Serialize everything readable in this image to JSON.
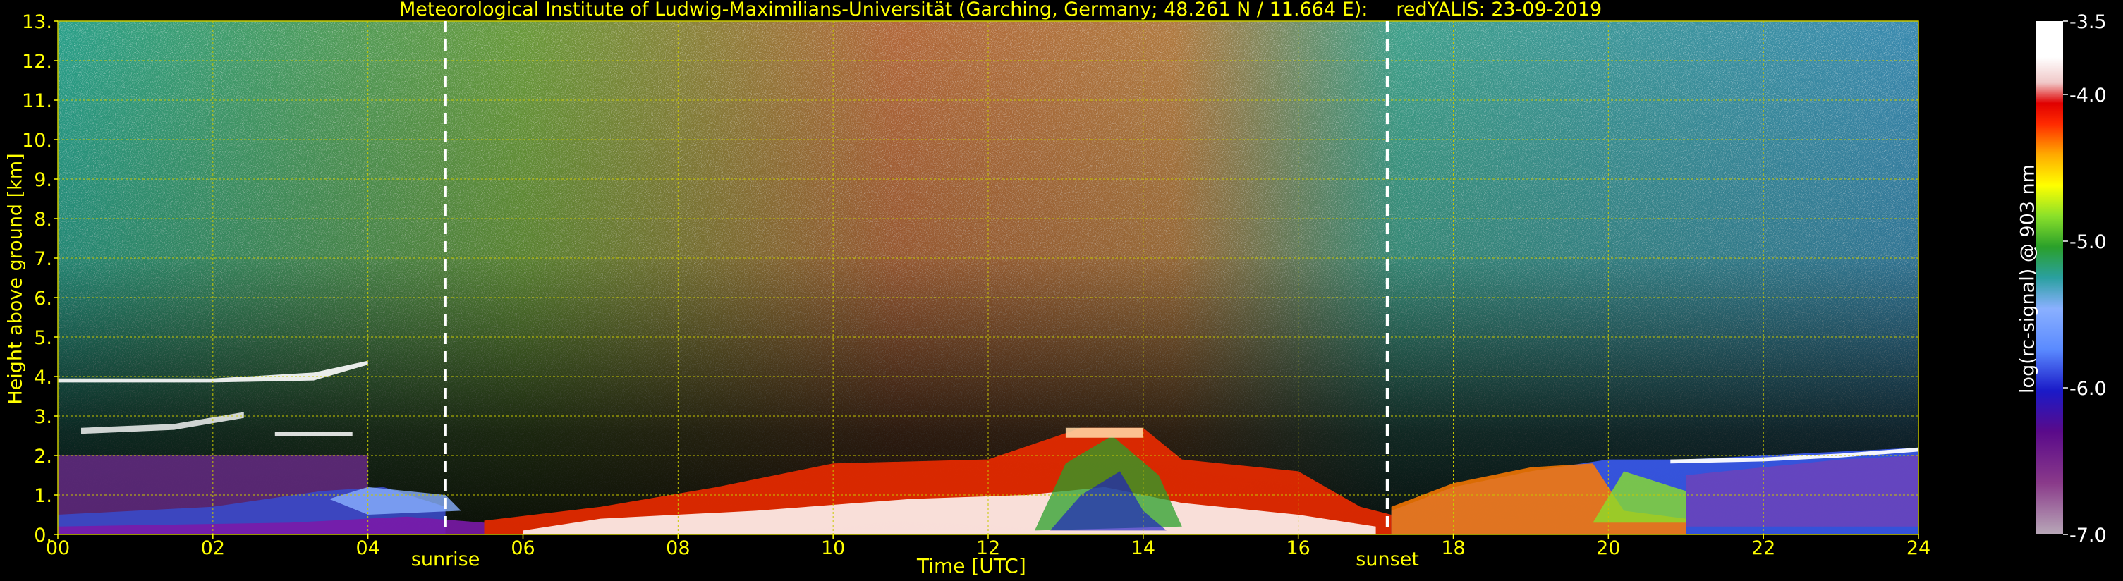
{
  "title": {
    "left": "Meteorological Institute of Ludwig-Maximilians-Universität (Garching, Germany; 48.261 N / 11.664 E):",
    "right": "redYALIS: 23-09-2019"
  },
  "chart_data": {
    "type": "heatmap",
    "xlabel": "Time [UTC]",
    "ylabel": "Height above ground [km]",
    "xlim": [
      0,
      24
    ],
    "ylim": [
      0,
      13
    ],
    "x_ticks": [
      "00",
      "02",
      "04",
      "06",
      "08",
      "10",
      "12",
      "14",
      "16",
      "18",
      "20",
      "22",
      "24"
    ],
    "y_ticks": [
      "0.",
      "1.",
      "2.",
      "3.",
      "4.",
      "5.",
      "6.",
      "7.",
      "8.",
      "9.",
      "10.",
      "11.",
      "12.",
      "13."
    ],
    "grid": true,
    "events": [
      {
        "name": "sunrise",
        "time": 5.0
      },
      {
        "name": "sunset",
        "time": 17.15
      }
    ],
    "colorbar": {
      "label": "log(rc-signal) @ 903 nm",
      "range": [
        -7.0,
        -3.5
      ],
      "ticks": [
        "-3.5",
        "-4.0",
        "-5.0",
        "-6.0",
        "-7.0"
      ]
    }
  },
  "colors": {
    "text": "#ffff00",
    "grid": "#c8c800",
    "background": "#000000",
    "event_line": "#ffffff"
  }
}
